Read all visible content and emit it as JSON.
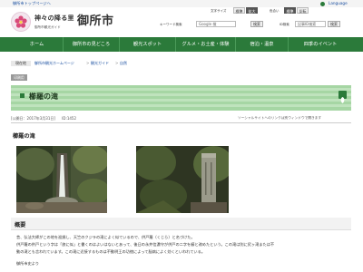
{
  "topbar": {
    "home_link": "御所市トップページへ",
    "language_link": "Language"
  },
  "header": {
    "tagline": "神々の降る里",
    "city": "御所市",
    "subtitle": "御所市観光ガイド",
    "font_size_label": "文字サイズ",
    "font_size_options": [
      "標準",
      "拡大"
    ],
    "color_label": "色合い",
    "color_options": [
      "標準",
      "反転"
    ],
    "keyword_label": "キーワード検索",
    "search_placeholder": "Google 検",
    "search_button": "検索",
    "id_label": "ID検索",
    "id_placeholder": "記事ID検索",
    "id_button": "検索"
  },
  "nav": {
    "items": [
      "ホーム",
      "御所市の見どころ",
      "観光スポット",
      "グルメ・お土産・体験",
      "宿泊・温泉",
      "四季のイベント"
    ]
  },
  "breadcrumb": {
    "label": "現在地",
    "items": [
      "御所市観光ホームページ",
      "観光ガイド",
      "自然"
    ]
  },
  "article": {
    "tag": "印刷用",
    "title": "櫛羅の滝",
    "updated": "[公開日：2017年3月31日]",
    "id": "ID:1452",
    "external_notice": "ソーシャルサイトへのリンクは別ウィンドウで開きます",
    "section1_heading": "櫛羅の滝",
    "section2_heading": "概要",
    "body_lines": [
      "昔、弘法大師がこの地を巡錫し、天竺のクジラの滝によく似ているので、供戸羅（くじら）と名づけた。",
      "供戸羅の供戸という字は「旅に似」と書くのはよいはないとあって、後日の永井信濃守が供戸の二字を櫛と改めたという。この滝は別に尻ヶ滝または不",
      "動の滝とも言われています。この滝に近接するものは不動明王の功徳によって脳病によく効くといわれている。"
    ],
    "footer_line": "御所市史より"
  },
  "colors": {
    "nav_bg": "#2b7a3a",
    "banner_bg": "#a6d6a4",
    "link": "#1a4fa0"
  },
  "icons": [
    "flower-logo-icon",
    "globe-icon",
    "leaf-emblem-icon"
  ]
}
